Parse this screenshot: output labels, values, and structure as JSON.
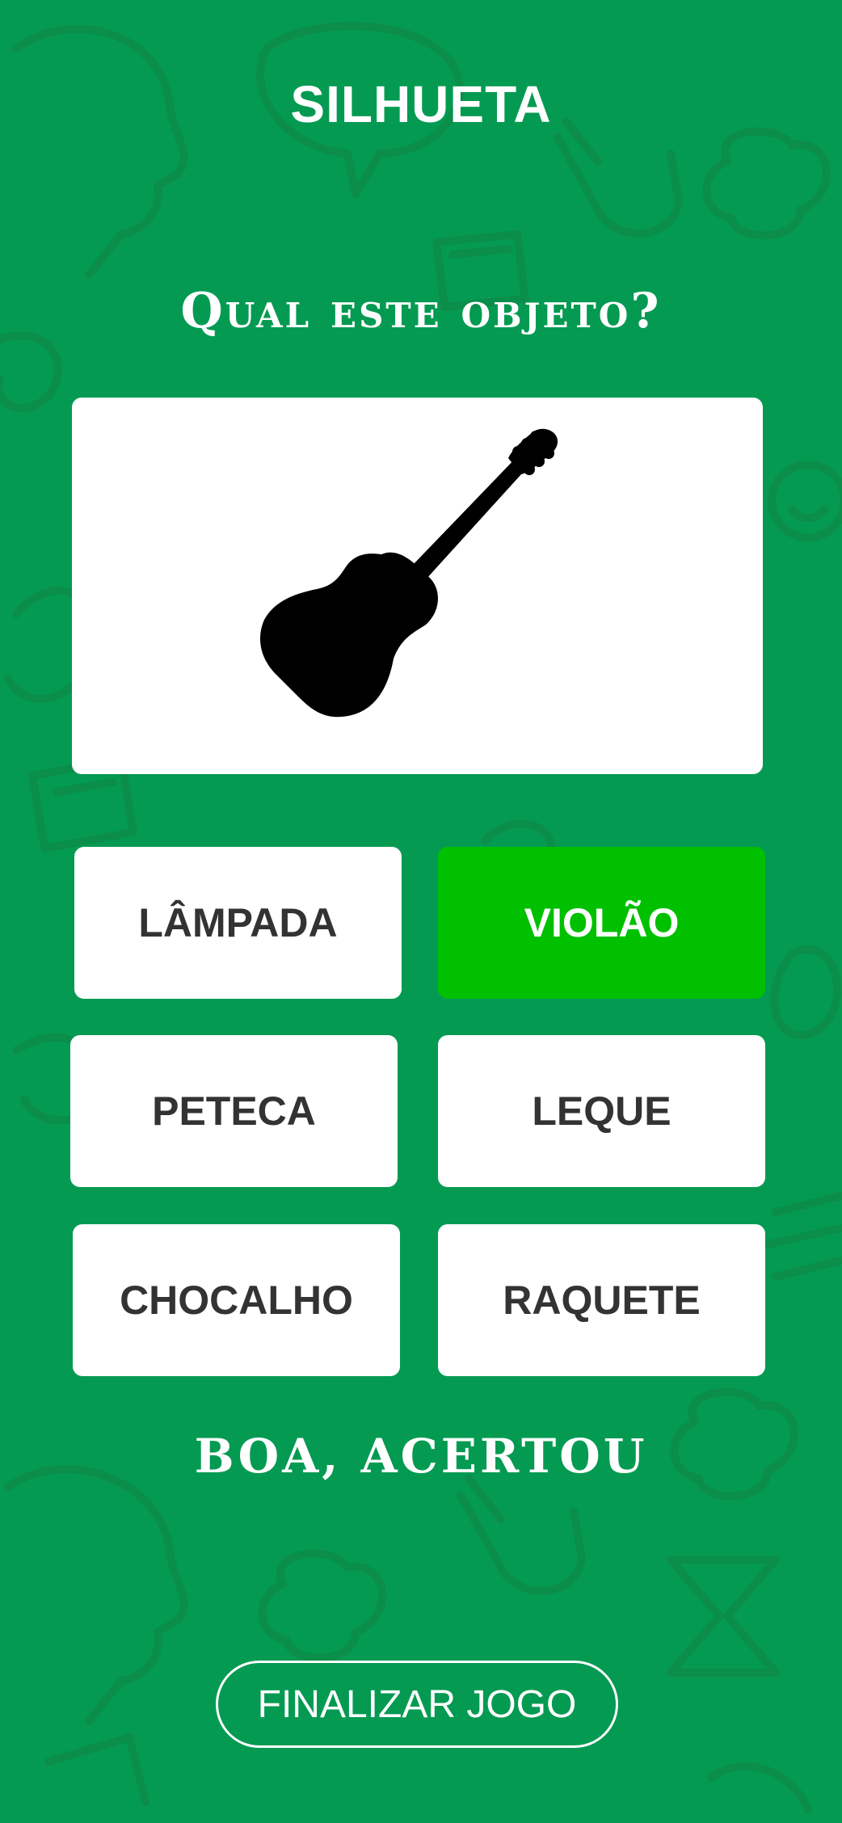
{
  "header": {
    "title": "SILHUETA"
  },
  "question": {
    "text": "Qual este objeto?"
  },
  "image": {
    "icon": "guitar-silhouette-icon"
  },
  "options": [
    {
      "label": "LÂMPADA",
      "state": "default"
    },
    {
      "label": "VIOLÃO",
      "state": "correct"
    },
    {
      "label": "PETECA",
      "state": "default"
    },
    {
      "label": "LEQUE",
      "state": "default"
    },
    {
      "label": "CHOCALHO",
      "state": "default"
    },
    {
      "label": "RAQUETE",
      "state": "default"
    }
  ],
  "feedback": {
    "text": "BOA, ACERTOU"
  },
  "footer": {
    "finish_label": "FINALIZAR JOGO"
  },
  "colors": {
    "background": "#059a52",
    "correct": "#00c000",
    "card": "#ffffff",
    "option_text": "#333333"
  }
}
